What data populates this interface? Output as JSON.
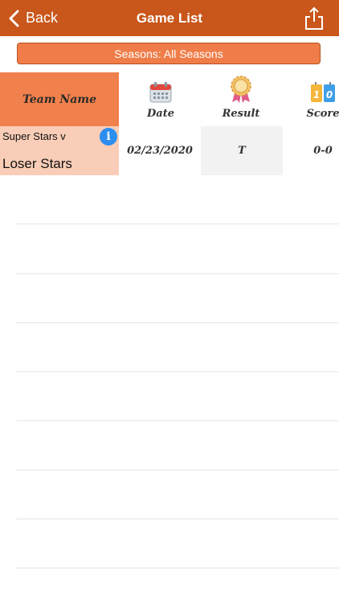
{
  "navbar": {
    "back_label": "Back",
    "title": "Game List",
    "bg_color": "#c9561a"
  },
  "season_filter": {
    "label": "Seasons: All Seasons"
  },
  "table": {
    "team_header": "Team Name",
    "columns": [
      {
        "key": "date",
        "label": "Date",
        "icon": "calendar-icon"
      },
      {
        "key": "result",
        "label": "Result",
        "icon": "award-ribbon-icon"
      },
      {
        "key": "score",
        "label": "Score",
        "icon": "scoreboard-icon"
      }
    ],
    "rows": [
      {
        "team_line1": "Super Stars v",
        "team_line2": "Loser Stars",
        "date": "02/23/2020",
        "result": "T",
        "score": "0-0"
      }
    ],
    "scoreboard_digits": [
      "1",
      "0"
    ]
  }
}
